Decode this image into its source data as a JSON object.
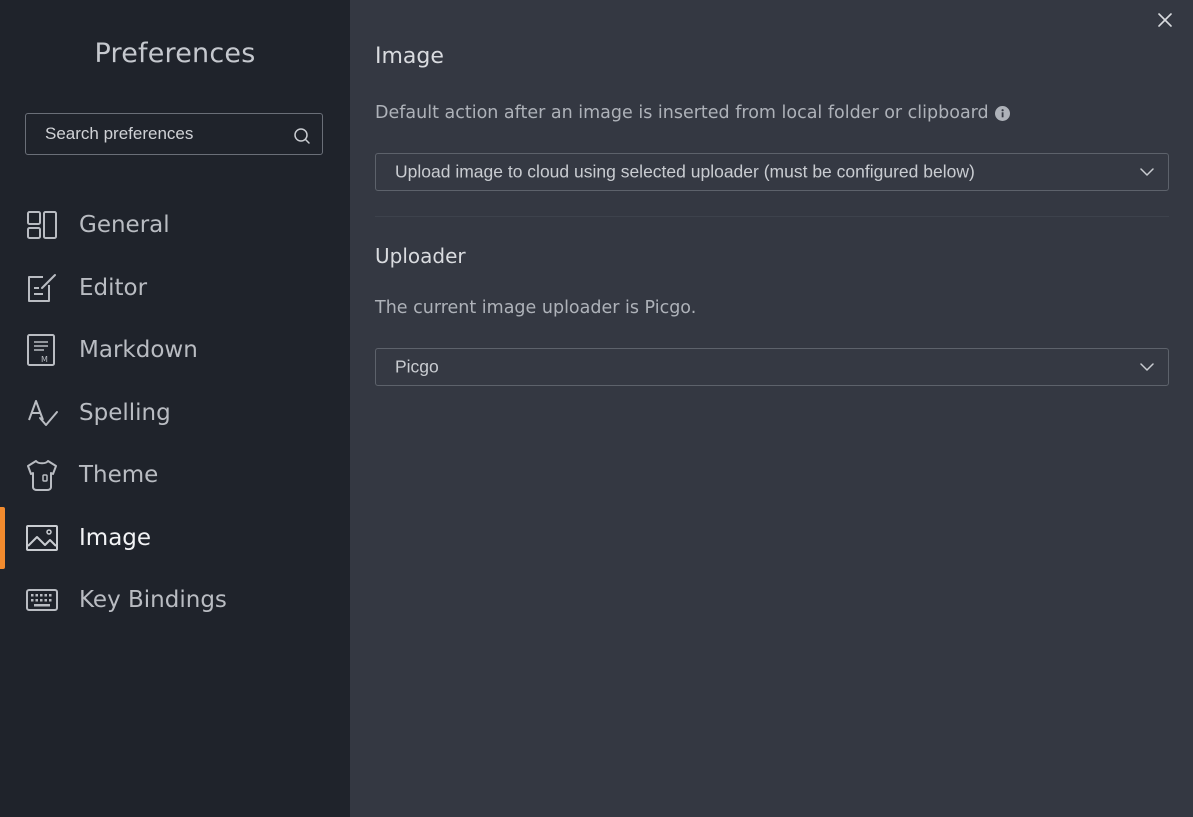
{
  "sidebar": {
    "title": "Preferences",
    "search": {
      "placeholder": "Search preferences",
      "value": ""
    },
    "items": [
      {
        "label": "General",
        "icon": "general-icon",
        "active": false
      },
      {
        "label": "Editor",
        "icon": "editor-icon",
        "active": false
      },
      {
        "label": "Markdown",
        "icon": "markdown-icon",
        "active": false
      },
      {
        "label": "Spelling",
        "icon": "spelling-icon",
        "active": false
      },
      {
        "label": "Theme",
        "icon": "theme-icon",
        "active": false
      },
      {
        "label": "Image",
        "icon": "image-icon",
        "active": true
      },
      {
        "label": "Key Bindings",
        "icon": "keyboard-icon",
        "active": false
      }
    ]
  },
  "main": {
    "image_section": {
      "title": "Image",
      "description": "Default action after an image is inserted from local folder or clipboard",
      "selected": "Upload image to cloud using selected uploader (must be configured below)"
    },
    "uploader_section": {
      "title": "Uploader",
      "description": "The current image uploader is Picgo.",
      "selected": "Picgo"
    }
  },
  "colors": {
    "sidebar_bg": "#1f232b",
    "main_bg": "#343842",
    "accent": "#f28b2e"
  }
}
